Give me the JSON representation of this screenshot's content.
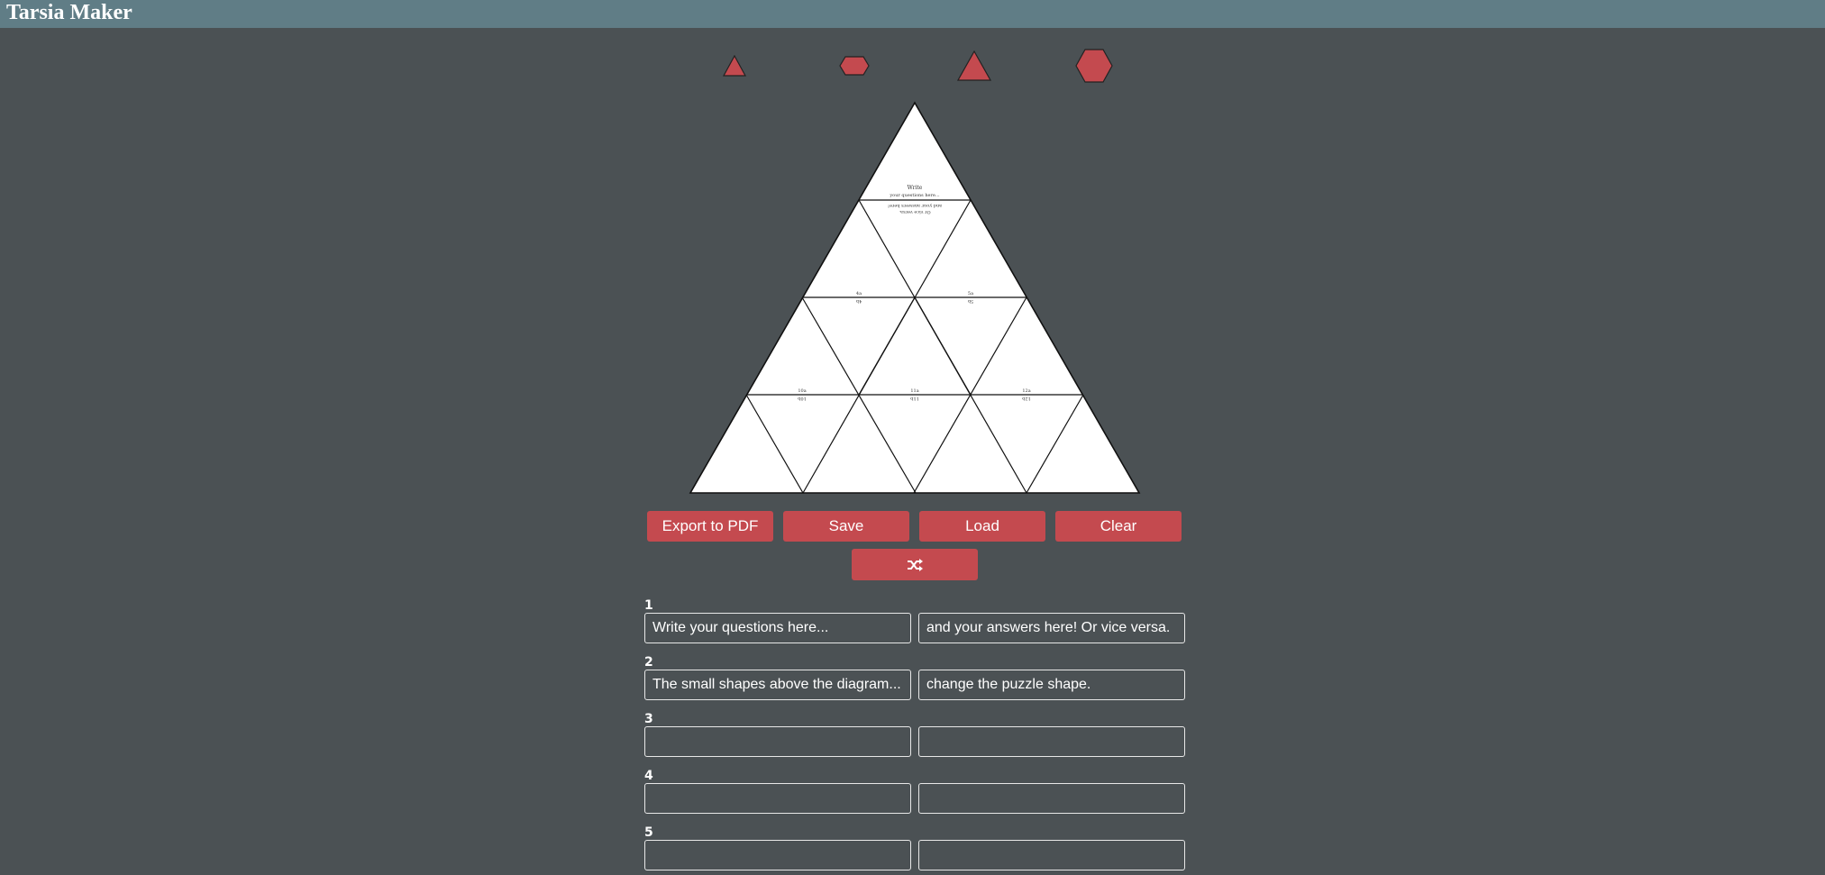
{
  "app": {
    "title": "Tarsia Maker"
  },
  "shapes": [
    {
      "name": "small-triangle"
    },
    {
      "name": "small-hexagon"
    },
    {
      "name": "large-triangle"
    },
    {
      "name": "large-hexagon"
    }
  ],
  "puzzle": {
    "tile_texts": {
      "top_q1": "Write",
      "top_q2": "your questions here...",
      "mid_a1": "and your answers here!",
      "mid_a2": "Or vice versa.",
      "t1": "4a",
      "t2": "4b",
      "t3": "5a",
      "t4": "5b",
      "t5": "10a",
      "t6": "10b",
      "t7": "11a",
      "t8": "11b",
      "t9": "12a",
      "t10": "12b"
    }
  },
  "toolbar": {
    "export_label": "Export to PDF",
    "save_label": "Save",
    "load_label": "Load",
    "clear_label": "Clear",
    "shuffle_icon": "shuffle-icon"
  },
  "rows": [
    {
      "num": "1",
      "question": "Write your questions here...",
      "answer": "and your answers here! Or vice versa."
    },
    {
      "num": "2",
      "question": "The small shapes above the diagram...",
      "answer": "change the puzzle shape."
    },
    {
      "num": "3",
      "question": "",
      "answer": ""
    },
    {
      "num": "4",
      "question": "",
      "answer": ""
    },
    {
      "num": "5",
      "question": "",
      "answer": ""
    }
  ],
  "colors": {
    "accent": "#c44a4f",
    "header": "#607d86",
    "background": "#4b5154"
  }
}
